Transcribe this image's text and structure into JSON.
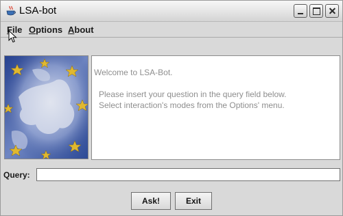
{
  "window": {
    "title": "LSA-bot",
    "app_icon": "java-cup-icon"
  },
  "menu": {
    "file": {
      "mnemonic": "F",
      "rest": "ile"
    },
    "options": {
      "mnemonic": "O",
      "rest": "ptions"
    },
    "about": {
      "mnemonic": "A",
      "rest": "bout"
    }
  },
  "messages": {
    "welcome": "Welcome to LSA-Bot.",
    "line1": "Please insert your question in the query field below.",
    "line2": "Select interaction's modes from the Options' menu."
  },
  "query": {
    "label": "Query:",
    "value": ""
  },
  "buttons": {
    "ask": "Ask!",
    "exit": "Exit"
  },
  "colors": {
    "window_bg": "#d9d9d9",
    "message_text": "#8e8e8e"
  },
  "icons": {
    "banner": "eu-flag-map-image",
    "minimize": "minimize-icon",
    "maximize": "maximize-icon",
    "close": "close-icon",
    "cursor": "mouse-pointer-icon"
  }
}
